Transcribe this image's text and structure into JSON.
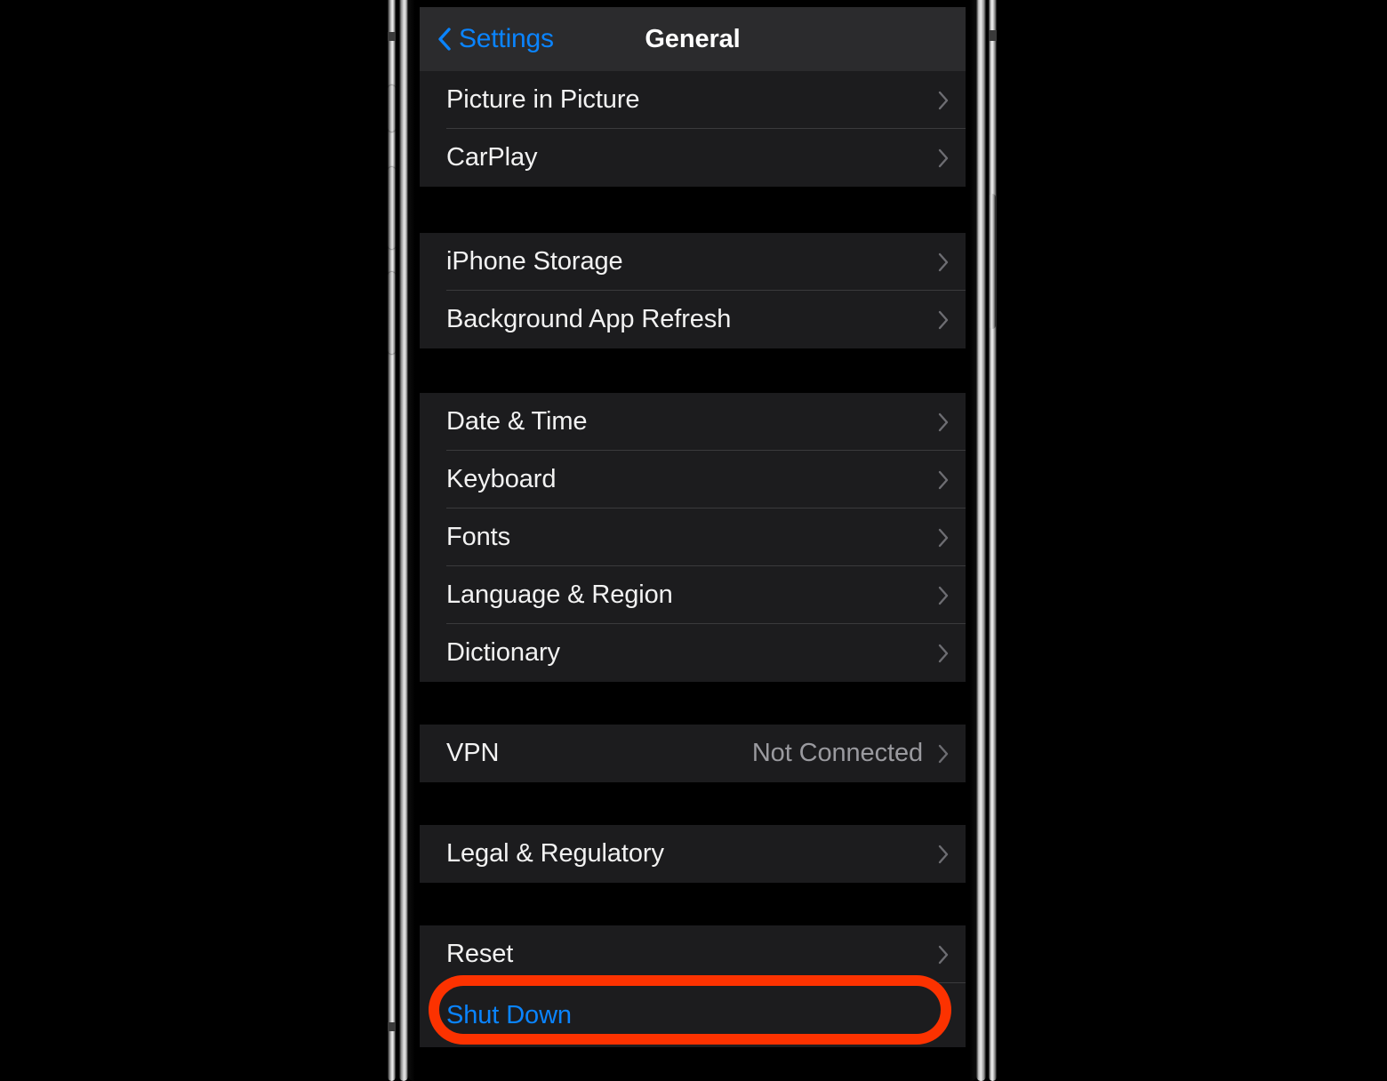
{
  "device": {
    "frame": "iphone-side-rails",
    "hardware_buttons": [
      "mute-switch",
      "volume-up",
      "volume-down",
      "side-button"
    ]
  },
  "colors": {
    "accent_blue": "#0a84ff",
    "annotation_red": "#fc3200",
    "navbar_bg": "#2b2b2d",
    "row_bg": "#1c1c1e",
    "screen_bg": "#000000",
    "divider": "#3a3a3c",
    "label": "#f2f2f2",
    "value": "#9a9a9f"
  },
  "navbar": {
    "back_label": "Settings",
    "title": "General",
    "back_icon": "chevron-left-icon"
  },
  "groups": [
    {
      "id": "media-group",
      "rows": [
        {
          "label": "Picture in Picture",
          "value": "",
          "accessory": "chevron-right-icon",
          "style": "nav"
        },
        {
          "label": "CarPlay",
          "value": "",
          "accessory": "chevron-right-icon",
          "style": "nav"
        }
      ]
    },
    {
      "id": "storage-group",
      "rows": [
        {
          "label": "iPhone Storage",
          "value": "",
          "accessory": "chevron-right-icon",
          "style": "nav"
        },
        {
          "label": "Background App Refresh",
          "value": "",
          "accessory": "chevron-right-icon",
          "style": "nav"
        }
      ]
    },
    {
      "id": "localization-group",
      "rows": [
        {
          "label": "Date & Time",
          "value": "",
          "accessory": "chevron-right-icon",
          "style": "nav"
        },
        {
          "label": "Keyboard",
          "value": "",
          "accessory": "chevron-right-icon",
          "style": "nav"
        },
        {
          "label": "Fonts",
          "value": "",
          "accessory": "chevron-right-icon",
          "style": "nav"
        },
        {
          "label": "Language & Region",
          "value": "",
          "accessory": "chevron-right-icon",
          "style": "nav"
        },
        {
          "label": "Dictionary",
          "value": "",
          "accessory": "chevron-right-icon",
          "style": "nav"
        }
      ]
    },
    {
      "id": "vpn-group",
      "rows": [
        {
          "label": "VPN",
          "value": "Not Connected",
          "accessory": "chevron-right-icon",
          "style": "nav"
        }
      ]
    },
    {
      "id": "legal-group",
      "rows": [
        {
          "label": "Legal & Regulatory",
          "value": "",
          "accessory": "chevron-right-icon",
          "style": "nav"
        }
      ]
    },
    {
      "id": "reset-group",
      "rows": [
        {
          "label": "Reset",
          "value": "",
          "accessory": "chevron-right-icon",
          "style": "nav"
        },
        {
          "label": "Shut Down",
          "value": "",
          "accessory": "none",
          "style": "action",
          "highlighted": true
        }
      ]
    }
  ]
}
